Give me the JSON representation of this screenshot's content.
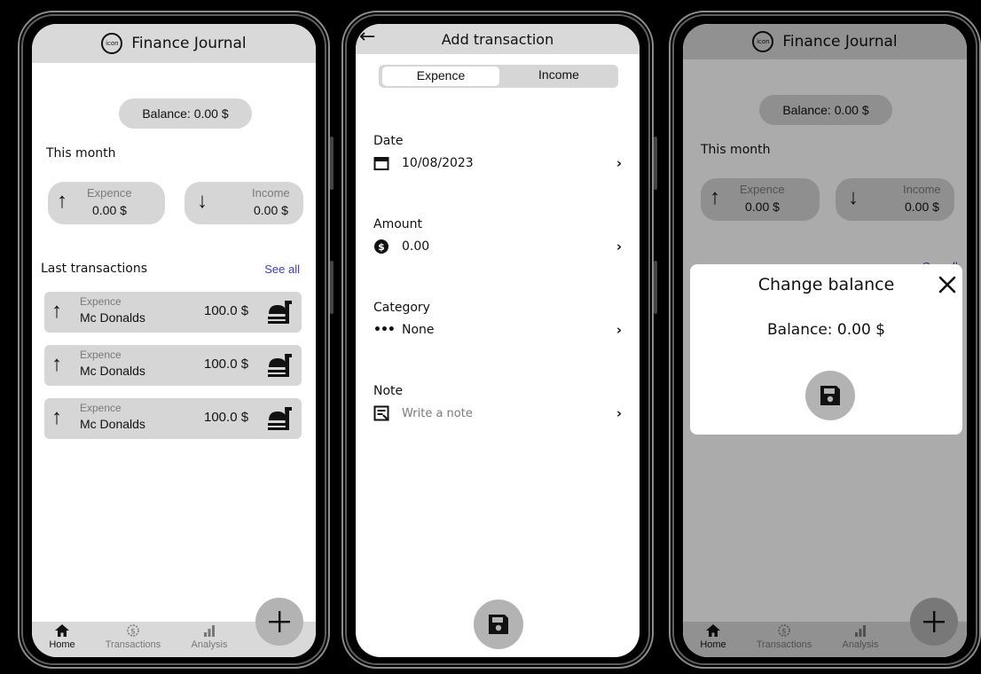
{
  "home": {
    "app_title": "Finance Journal",
    "logo_text": "icon",
    "balance_label": "Balance: 0.00 $",
    "this_month": "This month",
    "expence_label": "Expence",
    "expence_value": "0.00 $",
    "income_label": "Income",
    "income_value": "0.00 $",
    "last_transactions": "Last transactions",
    "see_all": "See all",
    "transactions": [
      {
        "type": "Expence",
        "name": "Mc Donalds",
        "amount": "100.0 $",
        "icon": "fastfood-icon"
      },
      {
        "type": "Expence",
        "name": "Mc Donalds",
        "amount": "100.0 $",
        "icon": "fastfood-icon"
      },
      {
        "type": "Expence",
        "name": "Mc Donalds",
        "amount": "100.0 $",
        "icon": "fastfood-icon"
      }
    ],
    "nav": [
      {
        "label": "Home",
        "icon": "home-icon"
      },
      {
        "label": "Transactions",
        "icon": "dollar-circle-icon"
      },
      {
        "label": "Analysis",
        "icon": "bar-chart-icon"
      }
    ],
    "fab_icon": "plus-icon"
  },
  "add": {
    "title": "Add transaction",
    "tab_expence": "Expence",
    "tab_income": "Income",
    "date_label": "Date",
    "date_value": "10/08/2023",
    "amount_label": "Amount",
    "amount_value": "0.00",
    "category_label": "Category",
    "category_value": "None",
    "note_label": "Note",
    "note_placeholder": "Write a note",
    "save_icon": "save-icon"
  },
  "dialog": {
    "title": "Change balance",
    "balance": "Balance: 0.00 $",
    "see_all_partial": "See all"
  },
  "colors": {
    "topbar": "#d9d9d9",
    "pill": "#d6d6d6",
    "link": "#3b3bd1",
    "fab": "#b3b3b3"
  }
}
